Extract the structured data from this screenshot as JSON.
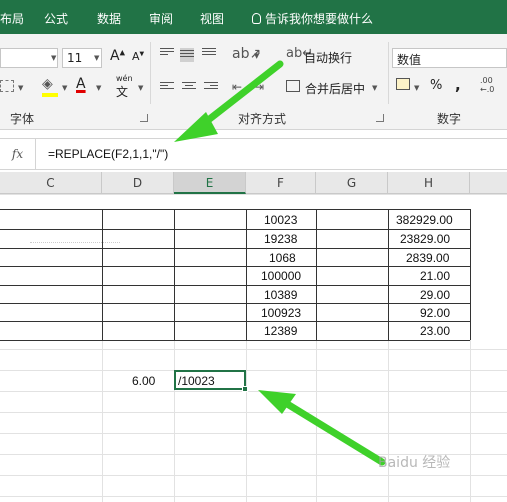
{
  "tabs": [
    "布局",
    "公式",
    "数据",
    "审阅",
    "视图"
  ],
  "tell_me": "告诉我你想要做什么",
  "ribbon": {
    "font_size": "11",
    "font_grow": "A",
    "font_shrink": "A",
    "bold_a": "A",
    "wen": "wén",
    "wen_char": "文",
    "wrap_text": "自动换行",
    "merge_center": "合并后居中",
    "number_format": "数值",
    "percent": "%",
    "comma": ",",
    "decimals": ".00 ←.0",
    "group_font": "字体",
    "group_align": "对齐方式",
    "group_number": "数字"
  },
  "formula_bar": {
    "fx": "fx",
    "formula": "=REPLACE(F2,1,1,\"/\")"
  },
  "columns": [
    "C",
    "D",
    "E",
    "F",
    "G",
    "H"
  ],
  "table": {
    "f_values": [
      "10023",
      "19238",
      "1068",
      "100000",
      "10389",
      "100923",
      "12389"
    ],
    "h_values": [
      "382929.00",
      "23829.00",
      "2839.00",
      "21.00",
      "29.00",
      "92.00",
      "23.00"
    ]
  },
  "d_value": "6.00",
  "e_value": "/10023",
  "watermark": "Baidu 经验",
  "colors": {
    "excel_green": "#217346",
    "arrow_green": "#3fd12a"
  }
}
